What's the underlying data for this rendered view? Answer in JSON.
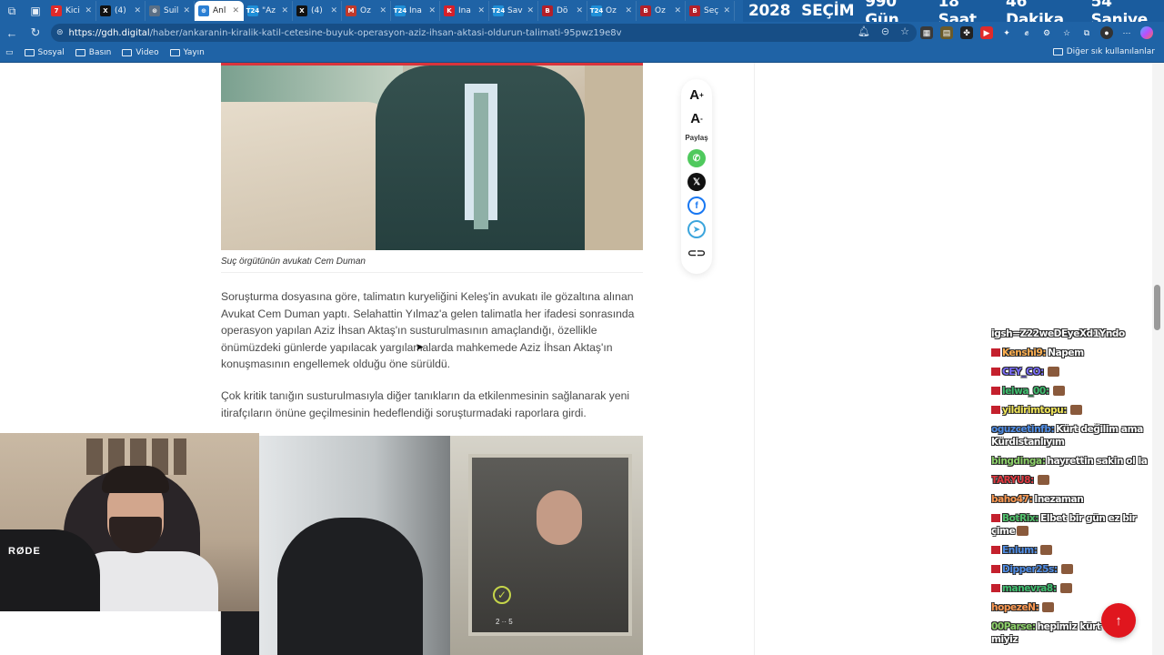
{
  "tabs": [
    {
      "label": "Kici",
      "fav": "7",
      "fav_color": "#e02a2a"
    },
    {
      "label": "(4)",
      "fav": "X",
      "fav_color": "#111111"
    },
    {
      "label": "Suil",
      "fav": "⊛",
      "fav_color": "#5a6f86"
    },
    {
      "label": "Anl",
      "fav": "⊕",
      "fav_color": "#2a7fd4",
      "active": true
    },
    {
      "label": "\"Az",
      "fav": "T24",
      "fav_color": "#1f8fd8"
    },
    {
      "label": "(4)",
      "fav": "X",
      "fav_color": "#111111"
    },
    {
      "label": "Öz",
      "fav": "M",
      "fav_color": "#c0392b"
    },
    {
      "label": "İna",
      "fav": "T24",
      "fav_color": "#1f8fd8"
    },
    {
      "label": "İna",
      "fav": "K",
      "fav_color": "#d6202a"
    },
    {
      "label": "Sav",
      "fav": "T24",
      "fav_color": "#1f8fd8"
    },
    {
      "label": "Dö",
      "fav": "B",
      "fav_color": "#b3202a"
    },
    {
      "label": "Öz",
      "fav": "T24",
      "fav_color": "#1f8fd8"
    },
    {
      "label": "Öz",
      "fav": "B",
      "fav_color": "#b3202a"
    },
    {
      "label": "Seç",
      "fav": "B",
      "fav_color": "#b3202a"
    }
  ],
  "countdown": {
    "year": "2028",
    "title": "SEÇİM",
    "days": "990 Gün",
    "hours": "18 Saat",
    "minutes": "46 Dakika",
    "seconds": "54 Saniye"
  },
  "address": {
    "host": "https://gdh.digital",
    "path": "/haber/ankaranin-kiralik-katil-cetesine-buyuk-operasyon-aziz-ihsan-aktasi-oldurun-talimati-95pwz19e8v"
  },
  "bookmarks": {
    "items": [
      "Sosyal",
      "Basın",
      "Video",
      "Yayın"
    ],
    "other": "Diğer sık kullanılanlar"
  },
  "article": {
    "caption": "Suç örgütünün avukatı Cem Duman",
    "paragraph1": "Soruşturma dosyasına göre, talimatın kuryeliğini Keleş'in avukatı ile gözaltına alınan Avukat Cem Duman yaptı. Selahattin Yılmaz'a gelen talimatla her ifadesi sonrasında operasyon yapılan Aziz İhsan Aktaş'ın susturulmasının amaçlandığı, özellikle önümüzdeki günlerde yapılacak yargılamalarda mahkemede Aziz İhsan Aktaş'ın konuşmasının engellemek olduğu öne sürüldü.",
    "paragraph2": "Çok kritik tanığın susturulmasıyla diğer tanıkların da etkilenmesinin sağlanarak yeni itirafçıların önüne geçilmesinin hedeflendiği soruşturmadaki raporlara girdi.",
    "plate": "2 ·· 5"
  },
  "share": {
    "font_up": "A",
    "font_up_sup": "+",
    "font_down": "A",
    "font_down_sup": "-",
    "label": "Paylaş",
    "icons": [
      "whatsapp-icon",
      "x-icon",
      "facebook-icon",
      "telegram-icon",
      "link-icon"
    ]
  },
  "webcam": {
    "mic_brand": "RØDE"
  },
  "chat": [
    {
      "user": "",
      "text": "igsh=Z22weDEyeXd1Yndo",
      "color": "#ffffff",
      "badge": false,
      "emote": false
    },
    {
      "user": "Kenshi9:",
      "text": "Napem",
      "color": "#ffb050",
      "badge": true,
      "emote": false
    },
    {
      "user": "CEY_CO:",
      "text": "",
      "color": "#7a6cff",
      "badge": true,
      "emote": true
    },
    {
      "user": "lelwa_00:",
      "text": "",
      "color": "#3fbf6f",
      "badge": true,
      "emote": true
    },
    {
      "user": "yildirimtopu:",
      "text": "",
      "color": "#f3e85a",
      "badge": true,
      "emote": true
    },
    {
      "user": "oguzcetinfb:",
      "text": "Kürt değilim ama Kürdistanlıyım",
      "color": "#4f8de6",
      "badge": false,
      "emote": false
    },
    {
      "user": "bingdinga:",
      "text": "hayrettin sakin ol la",
      "color": "#8ed36b",
      "badge": false,
      "emote": false
    },
    {
      "user": "TARYU8:",
      "text": "",
      "color": "#e0383f",
      "badge": false,
      "emote": true
    },
    {
      "user": "baho47:",
      "text": "Inezaman",
      "color": "#ff9a52",
      "badge": false,
      "emote": false
    },
    {
      "user": "BotRix:",
      "text": "Elbet bir gün ez bir çime",
      "color": "#51c16b",
      "badge": true,
      "emote": true
    },
    {
      "user": "Enlum:",
      "text": "",
      "color": "#4f8de6",
      "badge": true,
      "emote": true
    },
    {
      "user": "Dipper25s:",
      "text": "",
      "color": "#4f8de6",
      "badge": true,
      "emote": true
    },
    {
      "user": "manevra8:",
      "text": "",
      "color": "#3fbf6f",
      "badge": true,
      "emote": true
    },
    {
      "user": "hopezeN:",
      "text": "",
      "color": "#ff9a52",
      "badge": false,
      "emote": true
    },
    {
      "user": "00Parse:",
      "text": "hepimiz kürt değil miyiz",
      "color": "#8ed36b",
      "badge": false,
      "emote": false
    }
  ],
  "scroll_top": "↑"
}
